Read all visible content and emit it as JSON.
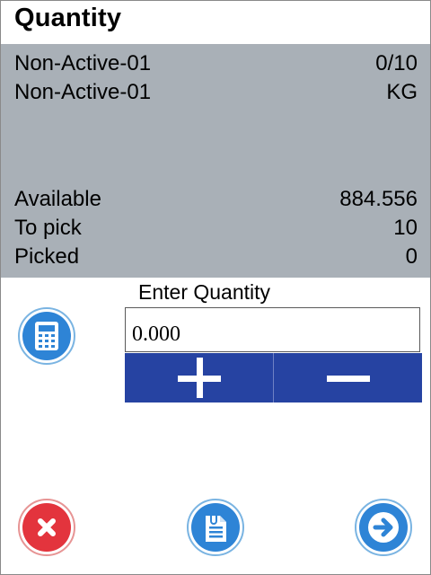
{
  "header": {
    "title": "Quantity"
  },
  "item": {
    "rows": [
      {
        "label": "Non-Active-01",
        "value": "0/10"
      },
      {
        "label": "Non-Active-01",
        "value": "KG"
      }
    ],
    "stats": [
      {
        "label": "Available",
        "value": "884.556"
      },
      {
        "label": "To pick",
        "value": "10"
      },
      {
        "label": "Picked",
        "value": "0"
      }
    ]
  },
  "entry": {
    "label": "Enter Quantity",
    "value": "0.000"
  },
  "icons": {
    "calculator": "calculator-icon",
    "plus": "plus-icon",
    "minus": "minus-icon",
    "cancel": "close-icon",
    "clipboard": "clipboard-icon",
    "next": "arrow-right-icon"
  },
  "colors": {
    "info_bg": "#a9b0b7",
    "stepper_bg": "#2643a2",
    "action_blue": "#2e84d6",
    "cancel_red": "#e3343d"
  }
}
